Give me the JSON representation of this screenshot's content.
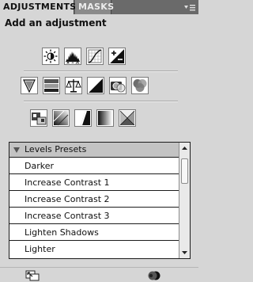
{
  "tabs": [
    {
      "label": "ADJUSTMENTS",
      "active": true
    },
    {
      "label": "MASKS",
      "active": false
    }
  ],
  "panel": {
    "title": "Add an adjustment"
  },
  "adjustment_rows": [
    [
      "brightness-contrast-icon",
      "levels-icon",
      "curves-icon",
      "exposure-icon"
    ],
    [
      "vibrance-icon",
      "hue-saturation-icon",
      "color-balance-icon",
      "black-white-icon",
      "photo-filter-icon",
      "channel-mixer-icon"
    ],
    [
      "invert-icon",
      "posterize-icon",
      "threshold-icon",
      "gradient-map-icon",
      "selective-color-icon"
    ]
  ],
  "presets": {
    "header": "Levels Presets",
    "items": [
      "Darker",
      "Increase Contrast 1",
      "Increase Contrast 2",
      "Increase Contrast 3",
      "Lighten Shadows",
      "Lighter"
    ]
  },
  "footer": {
    "left_icon": "return-to-list-icon",
    "right_icon": "layer-visibility-icon"
  }
}
